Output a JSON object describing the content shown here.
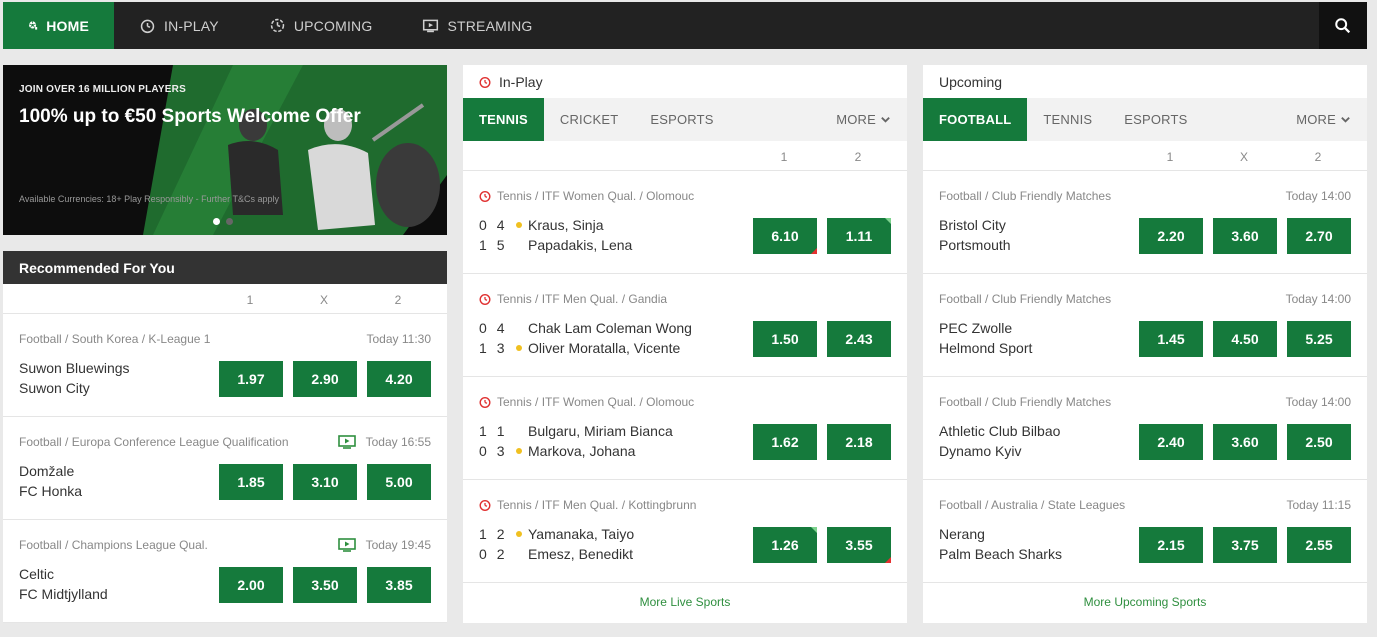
{
  "nav": {
    "items": [
      {
        "label": "HOME",
        "icon": "football-icon",
        "active": true
      },
      {
        "label": "IN-PLAY",
        "icon": "stopwatch-icon"
      },
      {
        "label": "UPCOMING",
        "icon": "clock-dashed-icon"
      },
      {
        "label": "STREAMING",
        "icon": "tv-icon"
      }
    ],
    "search_icon": "search-icon"
  },
  "promo": {
    "kicker": "JOIN OVER 16 MILLION PLAYERS",
    "headline": "100% up to €50 Sports Welcome Offer",
    "terms": "Available Currencies: 18+ Play Responsibly - Further T&Cs apply"
  },
  "recommended": {
    "title": "Recommended For You",
    "cols": [
      "1",
      "X",
      "2"
    ],
    "events": [
      {
        "meta": "Football / South Korea / K-League 1",
        "time": "Today 11:30",
        "tv": false,
        "home": "Suwon Bluewings",
        "away": "Suwon City",
        "odds": [
          "1.97",
          "2.90",
          "4.20"
        ]
      },
      {
        "meta": "Football / Europa Conference League Qualification",
        "time": "Today 16:55",
        "tv": true,
        "home": "Domžale",
        "away": "FC Honka",
        "odds": [
          "1.85",
          "3.10",
          "5.00"
        ]
      },
      {
        "meta": "Football / Champions League Qual.",
        "time": "Today 19:45",
        "tv": true,
        "home": "Celtic",
        "away": "FC Midtjylland",
        "odds": [
          "2.00",
          "3.50",
          "3.85"
        ]
      }
    ]
  },
  "inplay": {
    "title": "In-Play",
    "tabs": [
      "TENNIS",
      "CRICKET",
      "ESPORTS"
    ],
    "more": "MORE",
    "cols": [
      "1",
      "2"
    ],
    "events": [
      {
        "meta": "Tennis / ITF Women Qual. / Olomouc",
        "s1": [
          "0",
          "4"
        ],
        "s2": [
          "1",
          "5"
        ],
        "serve": 1,
        "home": "Kraus, Sinja",
        "away": "Papadakis, Lena",
        "odds": [
          "6.10",
          "1.11"
        ],
        "marks": [
          "dn",
          "up"
        ]
      },
      {
        "meta": "Tennis / ITF Men Qual. / Gandia",
        "s1": [
          "0",
          "4"
        ],
        "s2": [
          "1",
          "3"
        ],
        "serve": 2,
        "home": "Chak Lam Coleman Wong",
        "away": "Oliver Moratalla, Vicente",
        "odds": [
          "1.50",
          "2.43"
        ],
        "marks": [
          "",
          ""
        ]
      },
      {
        "meta": "Tennis / ITF Women Qual. / Olomouc",
        "s1": [
          "1",
          "1"
        ],
        "s2": [
          "0",
          "3"
        ],
        "serve": 2,
        "home": "Bulgaru, Miriam Bianca",
        "away": "Markova, Johana",
        "odds": [
          "1.62",
          "2.18"
        ],
        "marks": [
          "",
          ""
        ]
      },
      {
        "meta": "Tennis / ITF Men Qual. / Kottingbrunn",
        "s1": [
          "1",
          "2"
        ],
        "s2": [
          "0",
          "2"
        ],
        "serve": 1,
        "home": "Yamanaka, Taiyo",
        "away": "Emesz, Benedikt",
        "odds": [
          "1.26",
          "3.55"
        ],
        "marks": [
          "up",
          "dn"
        ]
      }
    ],
    "more_link": "More Live Sports"
  },
  "upcoming": {
    "title": "Upcoming",
    "tabs": [
      "FOOTBALL",
      "TENNIS",
      "ESPORTS"
    ],
    "more": "MORE",
    "cols": [
      "1",
      "X",
      "2"
    ],
    "events": [
      {
        "meta": "Football / Club Friendly Matches",
        "time": "Today 14:00",
        "home": "Bristol City",
        "away": "Portsmouth",
        "odds": [
          "2.20",
          "3.60",
          "2.70"
        ]
      },
      {
        "meta": "Football / Club Friendly Matches",
        "time": "Today 14:00",
        "home": "PEC Zwolle",
        "away": "Helmond Sport",
        "odds": [
          "1.45",
          "4.50",
          "5.25"
        ]
      },
      {
        "meta": "Football / Club Friendly Matches",
        "time": "Today 14:00",
        "home": "Athletic Club Bilbao",
        "away": "Dynamo Kyiv",
        "odds": [
          "2.40",
          "3.60",
          "2.50"
        ]
      },
      {
        "meta": "Football / Australia / State Leagues",
        "time": "Today 11:15",
        "home": "Nerang",
        "away": "Palm Beach Sharks",
        "odds": [
          "2.15",
          "3.75",
          "2.55"
        ]
      }
    ],
    "more_link": "More Upcoming Sports"
  },
  "colors": {
    "brand_green": "#157a3c",
    "nav_bg": "#222222",
    "live_red": "#e03030"
  }
}
